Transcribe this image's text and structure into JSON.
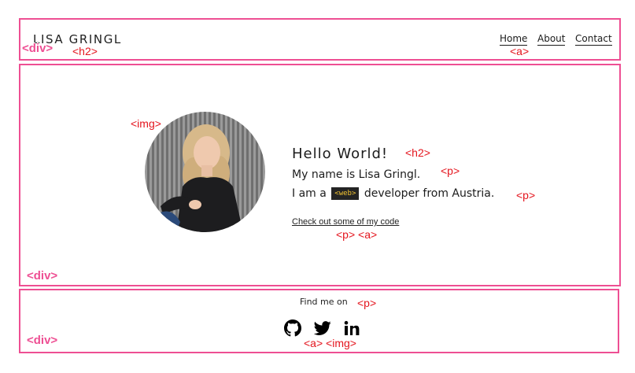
{
  "header": {
    "brand": "LISA GRINGL",
    "nav": [
      {
        "label": "Home"
      },
      {
        "label": "About"
      },
      {
        "label": "Contact"
      }
    ]
  },
  "main": {
    "greeting": "Hello World!",
    "intro": "My name is Lisa Gringl.",
    "role_prefix": "I am a",
    "role_badge": "<web>",
    "role_suffix": "developer from Austria.",
    "code_link": "Check out some of my code",
    "avatar_icon": "profile-photo"
  },
  "footer": {
    "find_me": "Find me on",
    "social": [
      {
        "icon": "github-icon"
      },
      {
        "icon": "twitter-icon"
      },
      {
        "icon": "linkedin-icon"
      }
    ]
  },
  "annotations": {
    "div": "<div>",
    "h2": "<h2>",
    "a": "<a>",
    "img": "<img>",
    "p": "<p>",
    "p_a": "<p> <a>",
    "a_img": "<a> <img>"
  },
  "colors": {
    "frame": "#ee4f93",
    "tag_text": "#e4141d",
    "badge_bg": "#242424",
    "badge_text": "#f1c232"
  }
}
